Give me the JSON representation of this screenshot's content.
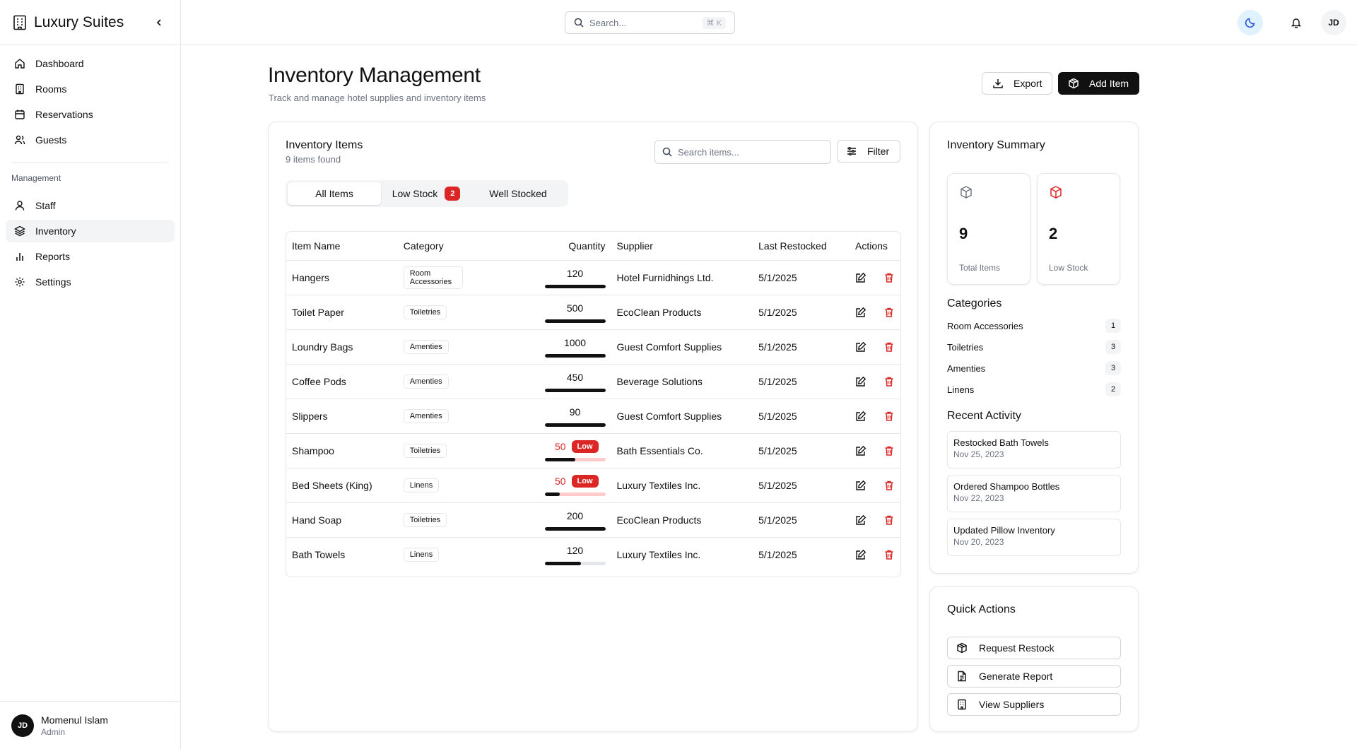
{
  "app": {
    "name": "Luxury Suites"
  },
  "sidebar": {
    "nav": [
      {
        "label": "Dashboard",
        "icon": "home-icon"
      },
      {
        "label": "Rooms",
        "icon": "building-icon"
      },
      {
        "label": "Reservations",
        "icon": "calendar-icon"
      },
      {
        "label": "Guests",
        "icon": "users-icon"
      }
    ],
    "section_label": "Management",
    "management": [
      {
        "label": "Staff",
        "icon": "user-icon"
      },
      {
        "label": "Inventory",
        "icon": "layers-icon",
        "active": true
      },
      {
        "label": "Reports",
        "icon": "bar-chart-icon"
      },
      {
        "label": "Settings",
        "icon": "gear-icon"
      }
    ],
    "user": {
      "initials": "JD",
      "name": "Momenul Islam",
      "role": "Admin"
    }
  },
  "topbar": {
    "search_placeholder": "Search...",
    "shortcut": "⌘ K",
    "avatar": "JD"
  },
  "header": {
    "title": "Inventory Management",
    "subtitle": "Track and manage hotel supplies and inventory items",
    "export_label": "Export",
    "add_label": "Add Item"
  },
  "inventory": {
    "title": "Inventory Items",
    "count_text": "9 items found",
    "search_placeholder": "Search items...",
    "filter_label": "Filter",
    "tabs": {
      "all": "All Items",
      "low": "Low Stock",
      "low_count": "2",
      "well": "Well Stocked"
    },
    "columns": [
      "Item Name",
      "Category",
      "Quantity",
      "Supplier",
      "Last Restocked",
      "Actions"
    ],
    "low_label": "Low",
    "rows": [
      {
        "name": "Hangers",
        "category": "Room Accessories",
        "quantity": "120",
        "level": 1.0,
        "low": false,
        "supplier": "Hotel Furnidhings Ltd.",
        "restocked": "5/1/2025"
      },
      {
        "name": "Toilet Paper",
        "category": "Toiletries",
        "quantity": "500",
        "level": 1.0,
        "low": false,
        "supplier": "EcoClean Products",
        "restocked": "5/1/2025"
      },
      {
        "name": "Loundry Bags",
        "category": "Amenties",
        "quantity": "1000",
        "level": 1.0,
        "low": false,
        "supplier": "Guest Comfort Supplies",
        "restocked": "5/1/2025"
      },
      {
        "name": "Coffee Pods",
        "category": "Amenties",
        "quantity": "450",
        "level": 1.0,
        "low": false,
        "supplier": "Beverage Solutions",
        "restocked": "5/1/2025"
      },
      {
        "name": "Slippers",
        "category": "Amenties",
        "quantity": "90",
        "level": 1.0,
        "low": false,
        "supplier": "Guest Comfort Supplies",
        "restocked": "5/1/2025"
      },
      {
        "name": "Shampoo",
        "category": "Toiletries",
        "quantity": "50",
        "level": 0.5,
        "low": true,
        "supplier": "Bath Essentials Co.",
        "restocked": "5/1/2025"
      },
      {
        "name": "Bed Sheets (King)",
        "category": "Linens",
        "quantity": "50",
        "level": 0.25,
        "low": true,
        "supplier": "Luxury Textiles Inc.",
        "restocked": "5/1/2025"
      },
      {
        "name": "Hand Soap",
        "category": "Toiletries",
        "quantity": "200",
        "level": 1.0,
        "low": false,
        "supplier": "EcoClean Products",
        "restocked": "5/1/2025"
      },
      {
        "name": "Bath Towels",
        "category": "Linens",
        "quantity": "120",
        "level": 0.6,
        "low": false,
        "supplier": "Luxury Textiles Inc.",
        "restocked": "5/1/2025"
      }
    ]
  },
  "summary": {
    "title": "Inventory Summary",
    "total_value": "9",
    "total_label": "Total Items",
    "low_value": "2",
    "low_label": "Low Stock",
    "categories_title": "Categories",
    "categories": [
      {
        "name": "Room Accessories",
        "count": "1"
      },
      {
        "name": "Toiletries",
        "count": "3"
      },
      {
        "name": "Amenties",
        "count": "3"
      },
      {
        "name": "Linens",
        "count": "2"
      }
    ],
    "activity_title": "Recent Activity",
    "activity": [
      {
        "title": "Restocked Bath Towels",
        "date": "Nov 25, 2023"
      },
      {
        "title": "Ordered Shampoo Bottles",
        "date": "Nov 22, 2023"
      },
      {
        "title": "Updated Pillow Inventory",
        "date": "Nov 20, 2023"
      }
    ]
  },
  "quick_actions": {
    "title": "Quick Actions",
    "items": [
      {
        "label": "Request Restock",
        "icon": "package-icon"
      },
      {
        "label": "Generate Report",
        "icon": "file-text-icon"
      },
      {
        "label": "View Suppliers",
        "icon": "building-icon"
      }
    ]
  },
  "colors": {
    "accent": "#111111",
    "danger": "#dc2626",
    "theme_toggle_bg": "#e0f2fe"
  }
}
